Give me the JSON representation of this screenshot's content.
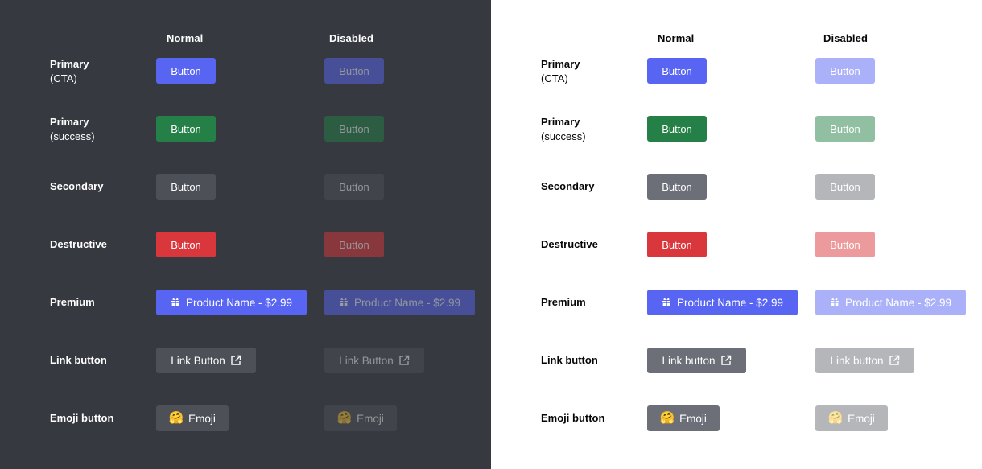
{
  "columns": {
    "normal": "Normal",
    "disabled": "Disabled"
  },
  "rows": {
    "primary_cta": {
      "title": "Primary",
      "sub": "(CTA)",
      "button": "Button"
    },
    "primary_success": {
      "title": "Primary",
      "sub": "(success)",
      "button": "Button"
    },
    "secondary": {
      "title": "Secondary",
      "button": "Button"
    },
    "destructive": {
      "title": "Destructive",
      "button": "Button"
    },
    "premium": {
      "title": "Premium",
      "button": "Product Name - $2.99",
      "icon": "gift-icon"
    },
    "link_dark": {
      "title": "Link button",
      "button": "Link Button",
      "icon": "external-link-icon"
    },
    "link_light": {
      "title": "Link button",
      "button": "Link button",
      "icon": "external-link-icon"
    },
    "emoji": {
      "title": "Emoji button",
      "button": "Emoji",
      "emoji": "🤗"
    }
  },
  "colors": {
    "dark_bg": "#36393f",
    "light_bg": "#ffffff",
    "blurple": "#5865f2",
    "green": "#248046",
    "red": "#da373c",
    "secondary_dark": "#4e5058",
    "secondary_light": "#6d6f78"
  }
}
